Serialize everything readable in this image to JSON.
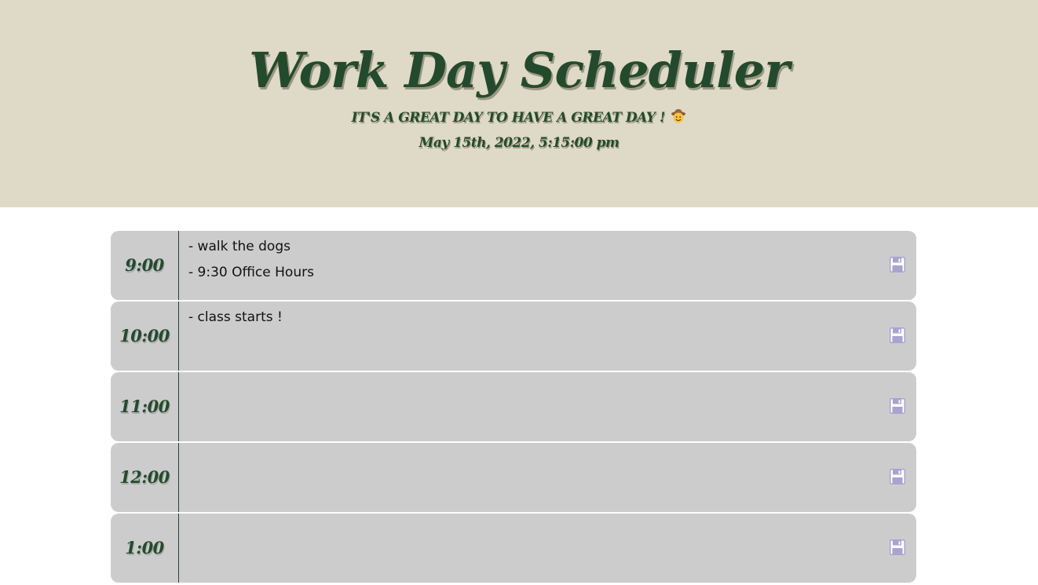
{
  "header": {
    "title": "Work Day Scheduler",
    "tagline": "IT'S A GREAT DAY TO HAVE A GREAT DAY !",
    "tagline_icon": "cowboy-face-icon",
    "current_datetime": "May 15th, 2022, 5:15:00 pm"
  },
  "colors": {
    "header_background": "#dfd9c7",
    "accent_green": "#244a2d",
    "row_background": "#cccccc",
    "save_icon": "#a8a3cf"
  },
  "rows": [
    {
      "hour": "9:00",
      "text": "- walk the dogs\n- 9:30 Office Hours",
      "save_icon": "floppy-disk-icon"
    },
    {
      "hour": "10:00",
      "text": "- class starts !",
      "save_icon": "floppy-disk-icon"
    },
    {
      "hour": "11:00",
      "text": "",
      "save_icon": "floppy-disk-icon"
    },
    {
      "hour": "12:00",
      "text": "",
      "save_icon": "floppy-disk-icon"
    },
    {
      "hour": "1:00",
      "text": "",
      "save_icon": "floppy-disk-icon"
    }
  ]
}
